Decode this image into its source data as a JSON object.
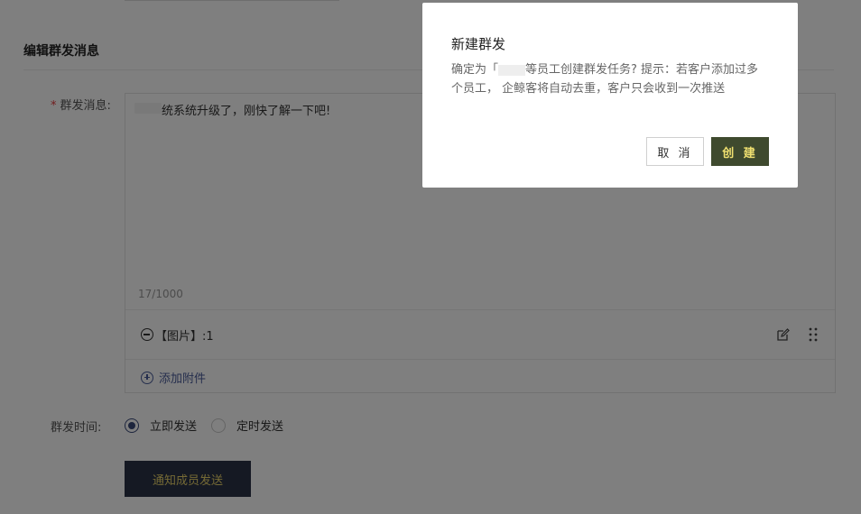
{
  "section": {
    "title": "编辑群发消息"
  },
  "form": {
    "message_label": "群发消息:",
    "required_mark": "*",
    "message_text": "统系统升级了，刚快了解一下吧!",
    "char_counter": "17/1000",
    "attachment_label": "【图片】:1",
    "add_attachment": "添加附件",
    "time_label": "群发时间:",
    "time_options": [
      {
        "label": "立即发送",
        "checked": true
      },
      {
        "label": "定时发送",
        "checked": false
      }
    ],
    "notify_button": "通知成员发送"
  },
  "modal": {
    "title": "新建群发",
    "body_prefix": "确定为「",
    "body_suffix": "等员工创建群发任务? 提示：若客户添加过多个员工， 企鲸客将自动去重，客户只会收到一次推送",
    "cancel_label": "取 消",
    "create_label": "创 建"
  },
  "colors": {
    "accent_dark": "#2b3346",
    "accent_gold": "#e8d26a",
    "create_bg": "#3f4a2e",
    "link_blue": "#4a5d9a",
    "required_red": "#e4393c"
  }
}
